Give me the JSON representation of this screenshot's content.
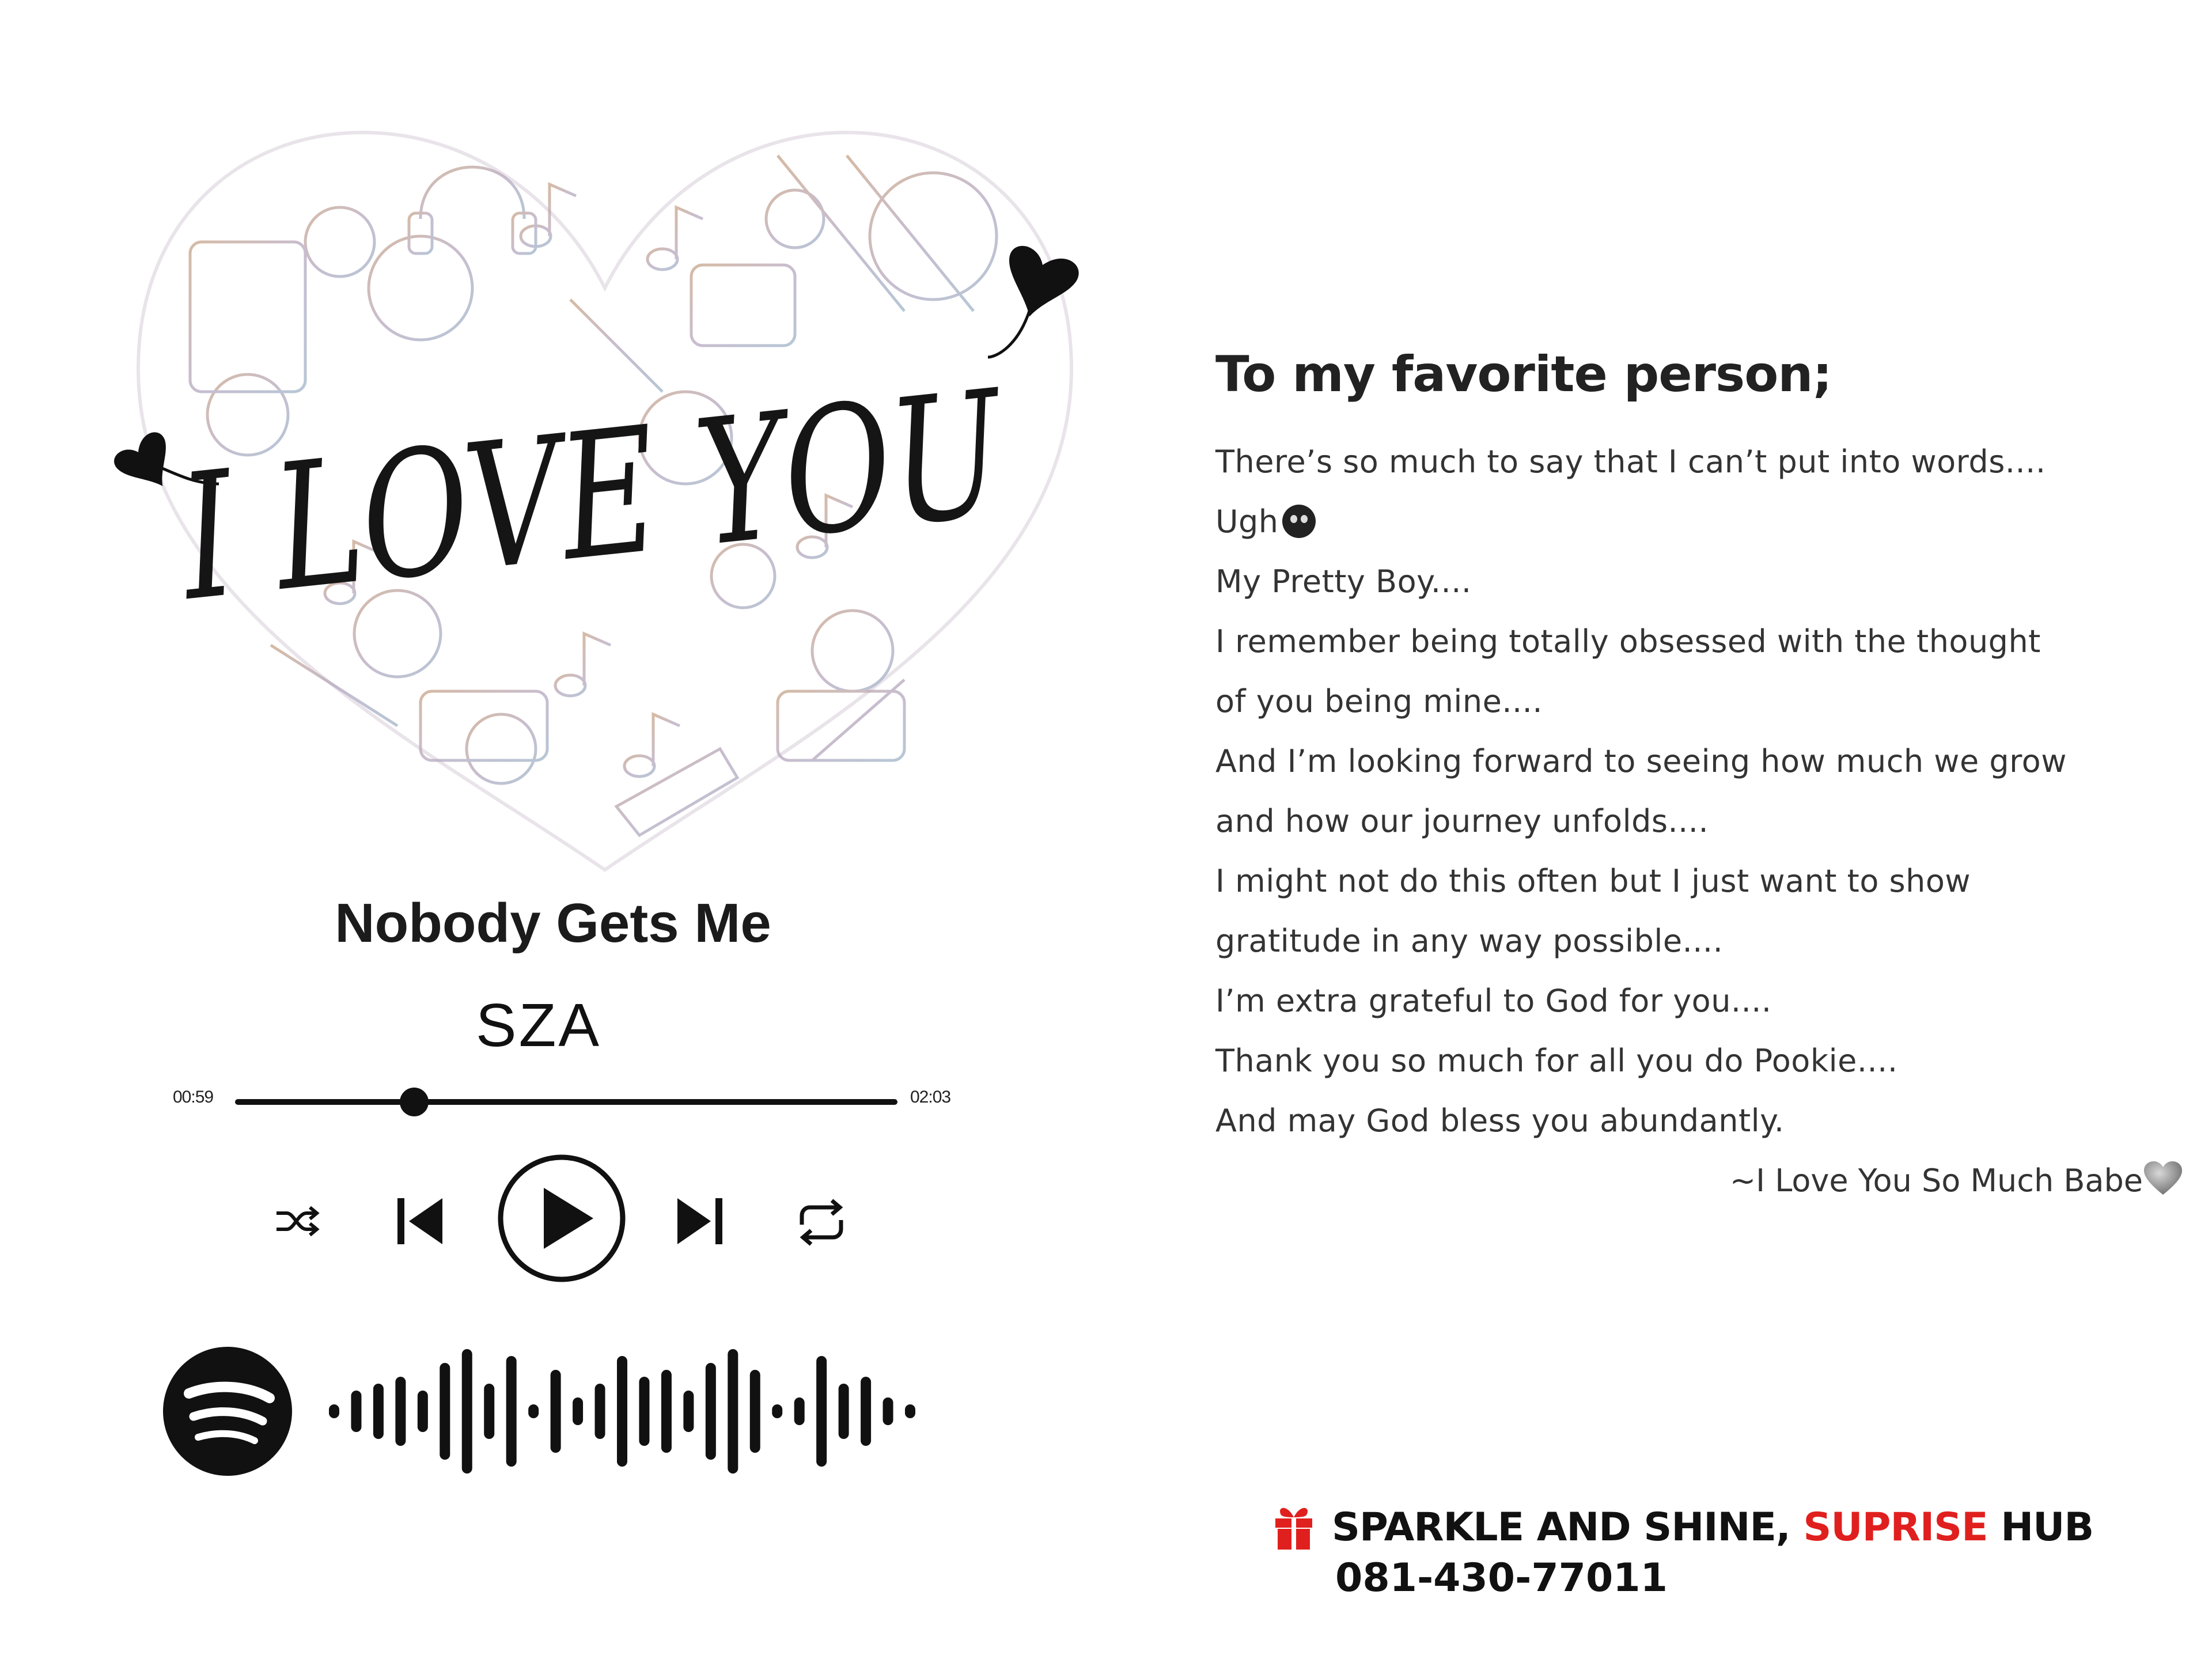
{
  "artwork": {
    "headline": "I LOVE YOU",
    "icon": "music-doodle-heart"
  },
  "player": {
    "song_title": "Nobody Gets Me",
    "artist": "SZA",
    "time_elapsed": "00:59",
    "time_total": "02:03",
    "progress_fraction": 0.27,
    "controls": {
      "shuffle_icon": "shuffle-icon",
      "previous_icon": "skip-previous-icon",
      "play_icon": "play-icon",
      "next_icon": "skip-next-icon",
      "repeat_icon": "repeat-icon"
    },
    "spotify_logo_icon": "spotify-icon",
    "spotify_code_bars": [
      1,
      3,
      4,
      5,
      3,
      7,
      9,
      4,
      8,
      1,
      6,
      2,
      4,
      8,
      5,
      6,
      3,
      7,
      9,
      6,
      1,
      2,
      8,
      4,
      5,
      2,
      1
    ]
  },
  "letter": {
    "heading": "To my favorite person;",
    "lines": [
      "There’s so much to say that I can’t put into words....",
      "Ugh",
      "My Pretty Boy....",
      "I remember being totally obsessed with the thought",
      "of you being mine....",
      "And I’m looking forward to seeing how much we grow",
      "and how our journey unfolds....",
      "I might not do this often but I just want to show",
      "gratitude in any way possible....",
      "I’m extra grateful to God for you....",
      "Thank you so much for all you do Pookie....",
      "And may God bless you abundantly."
    ],
    "signoff": "~I Love You So Much Babe"
  },
  "footer": {
    "gift_icon": "gift-icon",
    "brand_part1": "SPARKLE AND SHINE, ",
    "brand_accent": "SUPRISE",
    "brand_part2": " HUB",
    "phone": "081-430-77011",
    "accent_color": "#e0201e"
  }
}
